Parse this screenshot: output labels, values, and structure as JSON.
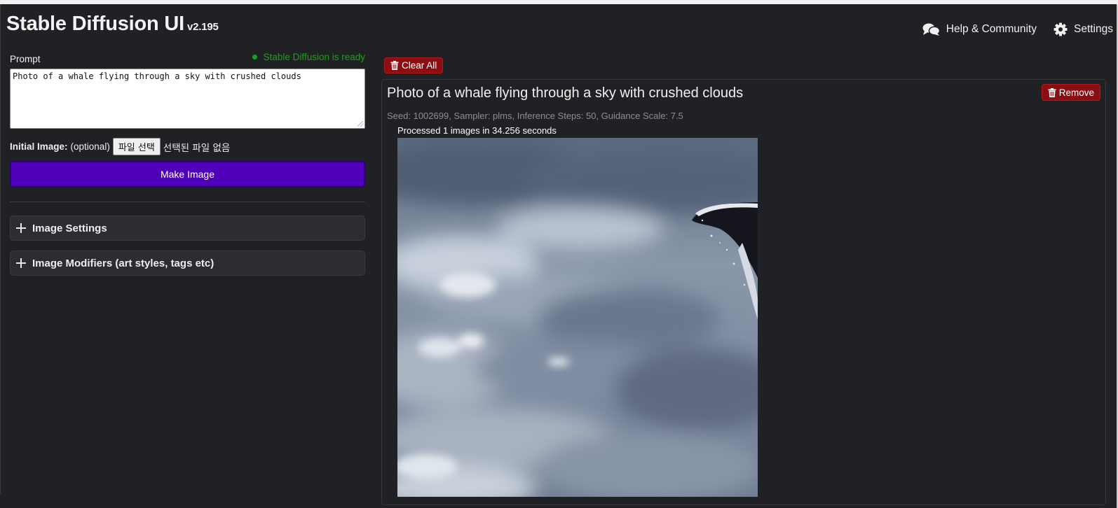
{
  "app": {
    "title": "Stable Diffusion UI",
    "version": "v2.195"
  },
  "nav": {
    "help_label": "Help & Community",
    "settings_label": "Settings"
  },
  "prompt": {
    "label": "Prompt",
    "value": "Photo of a whale flying through a sky with crushed clouds",
    "status_text": "Stable Diffusion is ready"
  },
  "init_image": {
    "label": "Initial Image:",
    "optional": "(optional)",
    "button_label": "파일 선택",
    "no_file_text": "선택된 파일 없음"
  },
  "make_button": "Make Image",
  "sections": {
    "image_settings": "Image Settings",
    "image_modifiers": "Image Modifiers (art styles, tags etc)"
  },
  "results": {
    "clear_all_label": "Clear All",
    "items": [
      {
        "title": "Photo of a whale flying through a sky with crushed clouds",
        "remove_label": "Remove",
        "meta": "Seed: 1002699, Sampler: plms, Inference Steps: 50, Guidance Scale: 7.5",
        "processed": "Processed 1 images in 34.256 seconds"
      }
    ]
  },
  "colors": {
    "background": "#202124",
    "primary_button": "#5000b9",
    "danger_button": "#8b0f12",
    "status_ready": "#1ca01c"
  }
}
